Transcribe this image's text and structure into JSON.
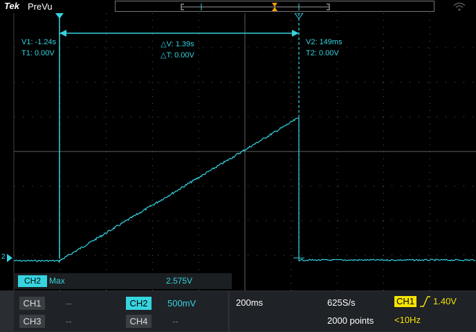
{
  "topbar": {
    "brand": "Tek",
    "mode": "PreVu"
  },
  "cursors": {
    "v1": "V1: -1.24s",
    "t1": "T1: 0.00V",
    "delta_v": "△V: 1.39s",
    "delta_t": "△T: 0.00V",
    "v2": "V2: 149ms",
    "t2": "T2: 0.00V"
  },
  "channel_marker": "2",
  "measurement": {
    "channel": "CH2",
    "type": "Max",
    "value": "2.575V"
  },
  "channels": [
    {
      "label": "CH1",
      "value": "--"
    },
    {
      "label": "CH2",
      "value": "500mV"
    },
    {
      "label": "CH3",
      "value": "--"
    },
    {
      "label": "CH4",
      "value": "--"
    }
  ],
  "horizontal": {
    "scale": "200ms",
    "sample_rate": "625S/s",
    "record_length": "2000 points"
  },
  "trigger": {
    "source": "CH1",
    "level": "1.40V",
    "frequency": "<10Hz"
  },
  "colors": {
    "ch2": "#35d4e0",
    "trigger": "#f5e400",
    "grid": "#6b6b6b",
    "background": "#000000"
  },
  "icons": [
    "wifi-icon",
    "trigger-slope-rising-icon",
    "trigger-position-marker-icon",
    "cursor-handle-icon"
  ]
}
